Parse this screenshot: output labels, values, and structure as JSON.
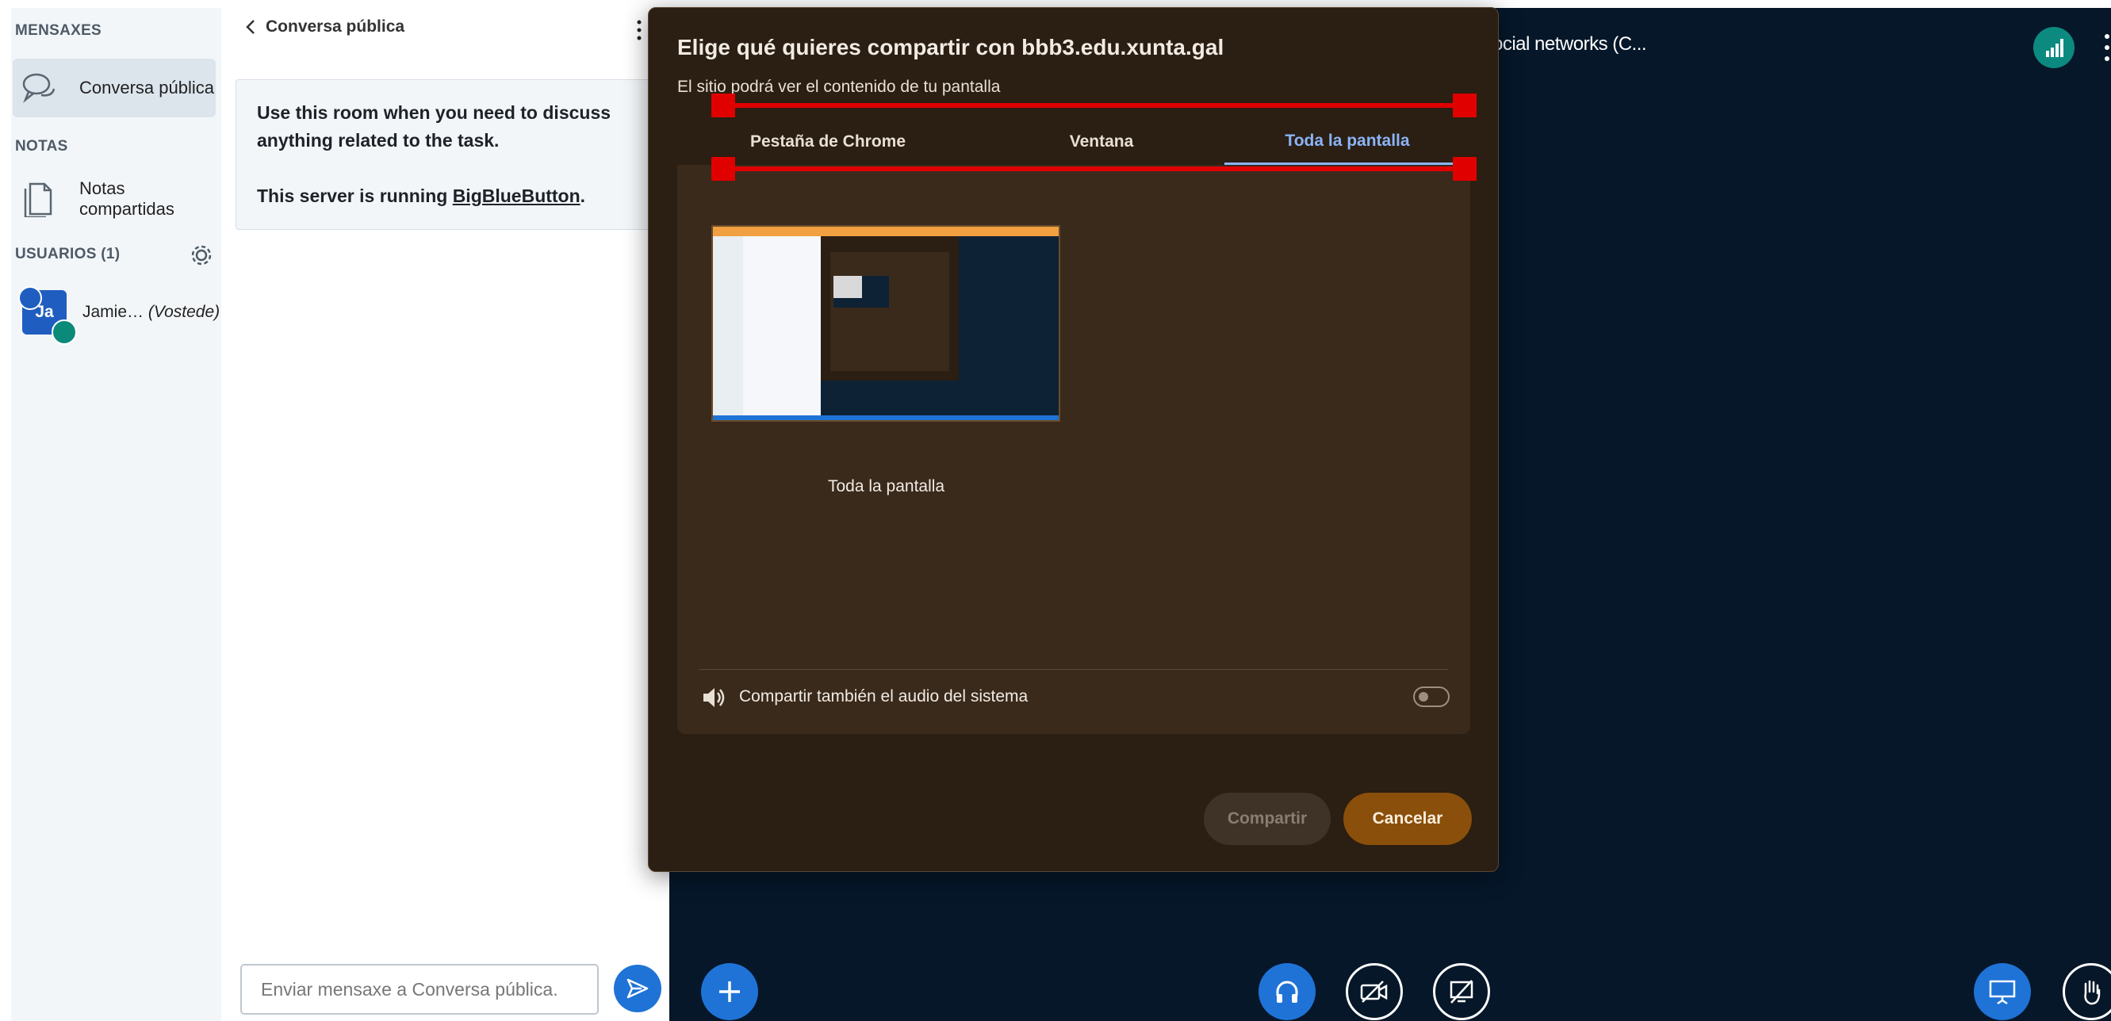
{
  "sidebar": {
    "messages_heading": "MENSAXES",
    "public_chat_label": "Conversa pública",
    "notes_heading": "NOTAS",
    "shared_notes_label": "Notas compartidas",
    "users_heading": "USUARIOS (1)",
    "user": {
      "initials": "Ja",
      "name": "Jamie…",
      "you_label": "(Vostede)"
    }
  },
  "chat": {
    "header_title": "Conversa pública",
    "welcome_line1": "Use this room when you need to discuss anything related to the task.",
    "welcome_prefix": "This server is running ",
    "welcome_link": "BigBlueButton",
    "welcome_suffix": ".",
    "input_placeholder": "Enviar mensaxe a Conversa pública."
  },
  "main": {
    "title": "ocial networks (C..."
  },
  "dialog": {
    "title": "Elige qué quieres compartir con bbb3.edu.xunta.gal",
    "subtitle": "El sitio podrá ver el contenido de tu pantalla",
    "tabs": [
      {
        "label": "Pestaña de Chrome",
        "active": false
      },
      {
        "label": "Ventana",
        "active": false
      },
      {
        "label": "Toda la pantalla",
        "active": true
      }
    ],
    "thumbnail_label": "Toda la pantalla",
    "audio_label": "Compartir también el audio del sistema",
    "audio_enabled": false,
    "share_button": "Compartir",
    "cancel_button": "Cancelar"
  },
  "colors": {
    "accent_blue": "#1f73d6",
    "dialog_bg": "#2b1e12",
    "active_tab": "#8ab4f8",
    "cancel_bg": "#8a4f0a",
    "annotation_red": "#e00000"
  },
  "icons": [
    "chat-bubbles-icon",
    "document-icon",
    "gear-icon",
    "chevron-left-icon",
    "kebab-icon",
    "send-icon",
    "plus-icon",
    "headphones-icon",
    "video-off-icon",
    "screen-share-off-icon",
    "presentation-icon",
    "raise-hand-icon",
    "connection-bars-icon",
    "speaker-icon"
  ]
}
